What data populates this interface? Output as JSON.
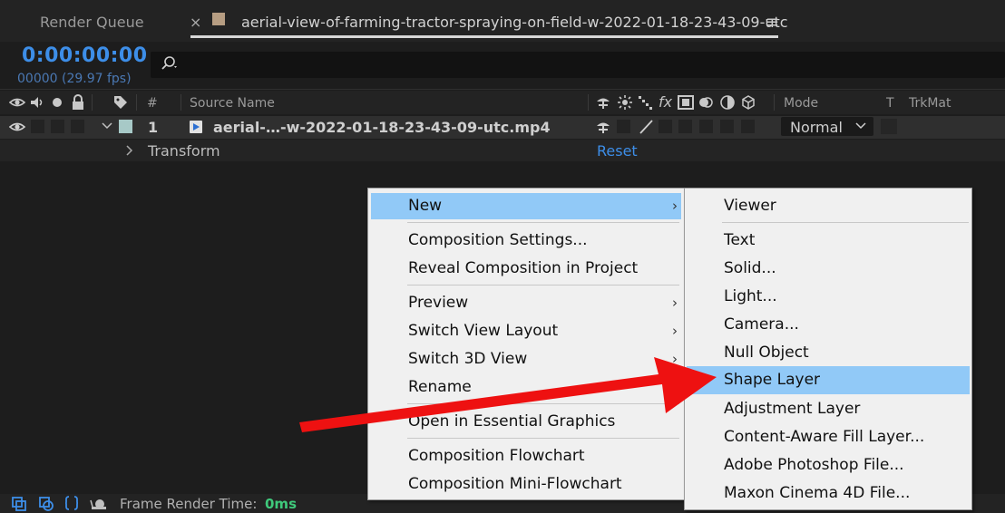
{
  "tabs": {
    "render_queue": "Render Queue",
    "close": "×",
    "composition_name": "aerial-view-of-farming-tractor-spraying-on-field-w-2022-01-18-23-43-09-utc",
    "menu_glyph": "≡"
  },
  "timecode": {
    "value": "0:00:00:00",
    "frames": "00000 (29.97 fps)"
  },
  "search": {
    "placeholder": ""
  },
  "columns": {
    "hash": "#",
    "source_name": "Source Name",
    "mode": "Mode",
    "t": "T",
    "trkmat": "TrkMat"
  },
  "layer": {
    "number": "1",
    "name": "aerial-…-w-2022-01-18-23-43-09-utc.mp4",
    "mode": "Normal",
    "transform_label": "Transform",
    "reset_label": "Reset",
    "label_color": "#a7c9c7"
  },
  "bottom_bar": {
    "frame_render_label": "Frame Render Time:",
    "frame_render_value": "0ms"
  },
  "context_menu": {
    "items": [
      {
        "label": "New",
        "has_submenu": true,
        "highlighted": true
      },
      {
        "label": "Composition Settings..."
      },
      {
        "label": "Reveal Composition in Project"
      },
      {
        "label": "Preview",
        "has_submenu": true
      },
      {
        "label": "Switch View Layout",
        "has_submenu": true
      },
      {
        "label": "Switch 3D View",
        "has_submenu": true
      },
      {
        "label": "Rename"
      },
      {
        "label": "Open in Essential Graphics"
      },
      {
        "label": "Composition Flowchart"
      },
      {
        "label": "Composition Mini-Flowchart"
      }
    ]
  },
  "submenu": {
    "items": [
      {
        "label": "Viewer"
      },
      {
        "label": "Text"
      },
      {
        "label": "Solid..."
      },
      {
        "label": "Light..."
      },
      {
        "label": "Camera..."
      },
      {
        "label": "Null Object"
      },
      {
        "label": "Shape Layer",
        "highlighted": true
      },
      {
        "label": "Adjustment Layer"
      },
      {
        "label": "Content-Aware Fill Layer..."
      },
      {
        "label": "Adobe Photoshop File..."
      },
      {
        "label": "Maxon Cinema 4D File..."
      }
    ]
  },
  "colors": {
    "accent_blue": "#3d8ee8",
    "highlight": "#91c9f7",
    "annotation_arrow": "#ee1111",
    "render_time_green": "#3fc97b"
  }
}
